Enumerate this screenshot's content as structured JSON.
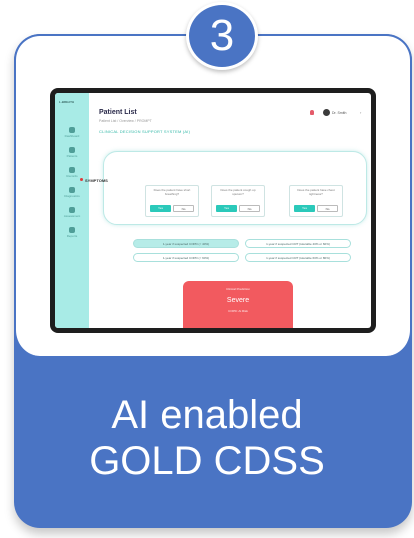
{
  "step_badge": "3",
  "card_title_line1": "AI enabled",
  "card_title_line2": "GOLD CDSS",
  "accent_color": "#4a74c4",
  "app": {
    "logo": "L-BREATH",
    "page_title": "Patient List",
    "page_subtitle": "Patient List / Overview / PROMPT",
    "section_title": "CLINICAL DECISION SUPPORT SYSTEM (AI)",
    "user_name": "Dr. Smith",
    "sidebar": [
      {
        "label": "Dashboard",
        "icon": "dashboard-icon"
      },
      {
        "label": "Patients",
        "icon": "patients-icon"
      },
      {
        "label": "Records",
        "icon": "records-icon"
      },
      {
        "label": "Diagnostics",
        "icon": "diagnostics-icon"
      },
      {
        "label": "Assessment",
        "icon": "assessment-icon"
      },
      {
        "label": "Reports",
        "icon": "reports-icon"
      }
    ],
    "symptoms_label": "SYMPTOMS",
    "questions": [
      {
        "text": "Does the patient have short breathing?",
        "yes": "Yes",
        "no": "No"
      },
      {
        "text": "Does the patient cough up sputum?",
        "yes": "Yes",
        "no": "No"
      },
      {
        "text": "Does the patient have chest tightness?",
        "yes": "Yes",
        "no": "No"
      }
    ],
    "pills": [
      "1-year if suspected COPD (< 40%)",
      "1-year if suspected CRT (tolerable 40% or 60%)",
      "1-year if suspected COPD (< 60%)",
      "1-year if suspected CRT (tolerable 60% or 80%)"
    ],
    "severity_caption": "Clinical Prediction",
    "severity_value": "Severe",
    "severity_note": "COPD: At Risk"
  }
}
